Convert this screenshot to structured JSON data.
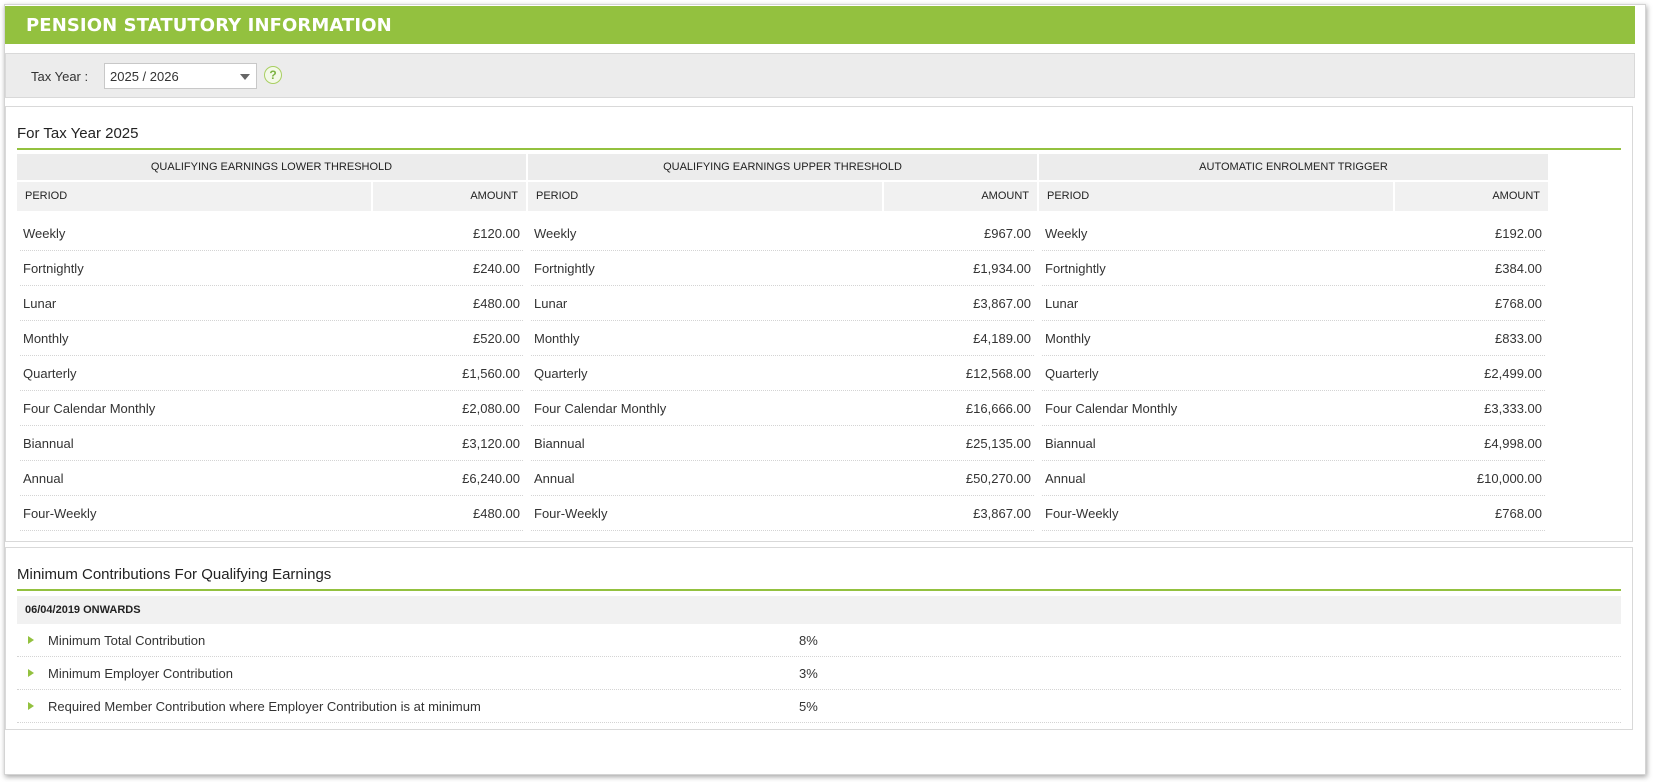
{
  "header": {
    "title": "PENSION STATUTORY INFORMATION"
  },
  "toolbar": {
    "tax_year_label": "Tax Year :",
    "tax_year_value": "2025 / 2026",
    "help_glyph": "?"
  },
  "thresholds": {
    "title": "For Tax Year 2025",
    "period_header": "PERIOD",
    "amount_header": "AMOUNT",
    "groups": [
      {
        "title": "QUALIFYING EARNINGS LOWER THRESHOLD",
        "rows": [
          {
            "period": "Weekly",
            "amount": "£120.00"
          },
          {
            "period": "Fortnightly",
            "amount": "£240.00"
          },
          {
            "period": "Lunar",
            "amount": "£480.00"
          },
          {
            "period": "Monthly",
            "amount": "£520.00"
          },
          {
            "period": "Quarterly",
            "amount": "£1,560.00"
          },
          {
            "period": "Four Calendar Monthly",
            "amount": "£2,080.00"
          },
          {
            "period": "Biannual",
            "amount": "£3,120.00"
          },
          {
            "period": "Annual",
            "amount": "£6,240.00"
          },
          {
            "period": "Four-Weekly",
            "amount": "£480.00"
          }
        ]
      },
      {
        "title": "QUALIFYING EARNINGS UPPER THRESHOLD",
        "rows": [
          {
            "period": "Weekly",
            "amount": "£967.00"
          },
          {
            "period": "Fortnightly",
            "amount": "£1,934.00"
          },
          {
            "period": "Lunar",
            "amount": "£3,867.00"
          },
          {
            "period": "Monthly",
            "amount": "£4,189.00"
          },
          {
            "period": "Quarterly",
            "amount": "£12,568.00"
          },
          {
            "period": "Four Calendar Monthly",
            "amount": "£16,666.00"
          },
          {
            "period": "Biannual",
            "amount": "£25,135.00"
          },
          {
            "period": "Annual",
            "amount": "£50,270.00"
          },
          {
            "period": "Four-Weekly",
            "amount": "£3,867.00"
          }
        ]
      },
      {
        "title": "AUTOMATIC ENROLMENT TRIGGER",
        "rows": [
          {
            "period": "Weekly",
            "amount": "£192.00"
          },
          {
            "period": "Fortnightly",
            "amount": "£384.00"
          },
          {
            "period": "Lunar",
            "amount": "£768.00"
          },
          {
            "period": "Monthly",
            "amount": "£833.00"
          },
          {
            "period": "Quarterly",
            "amount": "£2,499.00"
          },
          {
            "period": "Four Calendar Monthly",
            "amount": "£3,333.00"
          },
          {
            "period": "Biannual",
            "amount": "£4,998.00"
          },
          {
            "period": "Annual",
            "amount": "£10,000.00"
          },
          {
            "period": "Four-Weekly",
            "amount": "£768.00"
          }
        ]
      }
    ]
  },
  "contributions": {
    "title": "Minimum Contributions For Qualifying Earnings",
    "subheader": "06/04/2019 ONWARDS",
    "rows": [
      {
        "label": "Minimum Total Contribution",
        "value": "8%"
      },
      {
        "label": "Minimum Employer Contribution",
        "value": "3%"
      },
      {
        "label": "Required Member Contribution where Employer Contribution is at minimum",
        "value": "5%"
      }
    ]
  },
  "colors": {
    "accent": "#93c13f",
    "header_bg": "#ececec"
  }
}
